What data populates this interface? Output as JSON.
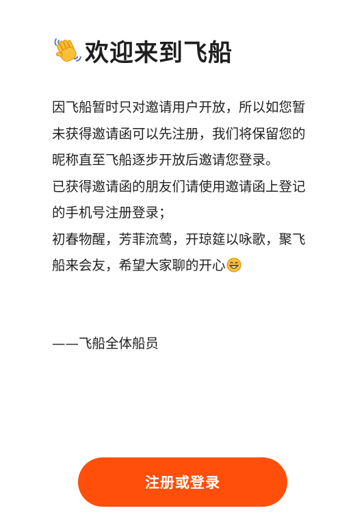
{
  "header": {
    "icon": "waving-hand-icon",
    "title": "欢迎来到飞船"
  },
  "message": {
    "paragraph_1": "因飞船暂时只对邀请用户开放，所以如您暂未获得邀请函可以先注册，我们将保留您的昵称直至飞船逐步开放后邀请您登录。",
    "paragraph_2": "已获得邀请函的朋友们请使用邀请函上登记的手机号注册登录；",
    "paragraph_3": "初春物醒，芳菲流莺，开琼筵以咏歌，聚飞船来会友，希望大家聊的开心",
    "paragraph_3_icon": "grinning-face-icon",
    "signature": "——飞船全体船员"
  },
  "actions": {
    "register_label": "注册或登录",
    "register_color": "#ff4f0a"
  }
}
